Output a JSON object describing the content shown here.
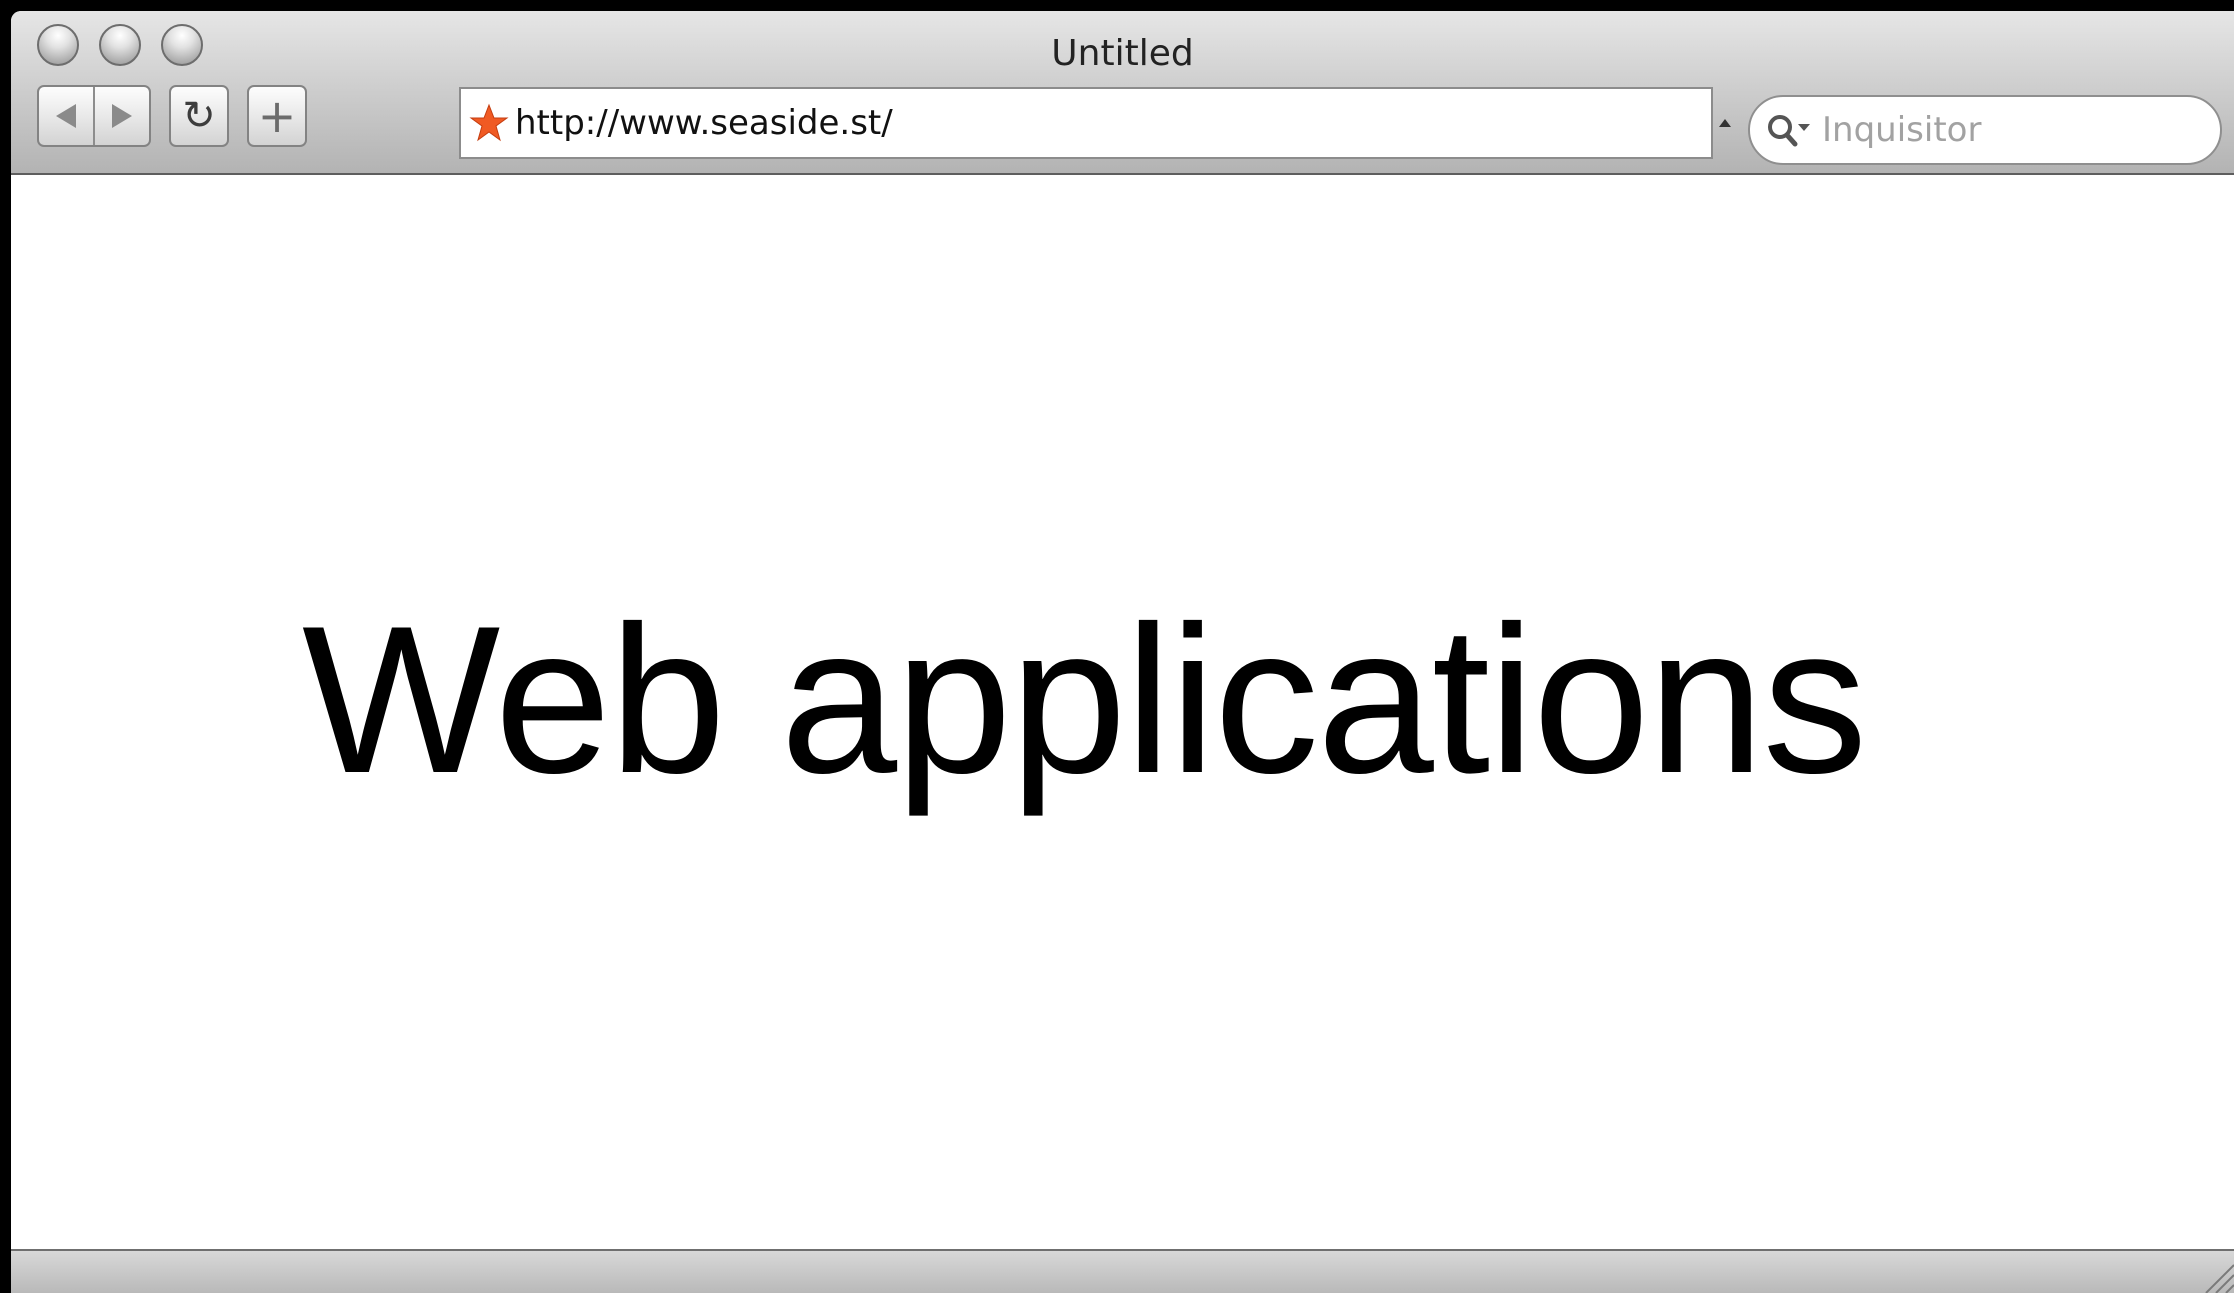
{
  "window": {
    "title": "Untitled"
  },
  "toolbar": {
    "back_icon": "back-arrow-icon",
    "forward_icon": "forward-arrow-icon",
    "reload_glyph": "↻",
    "add_bookmark_glyph": "+"
  },
  "address_bar": {
    "favicon": "starfish-icon",
    "url": "http://www.seaside.st/"
  },
  "search": {
    "placeholder": "Inquisitor"
  },
  "page": {
    "headline": "Web applications"
  },
  "colors": {
    "favicon": "#f05a23",
    "page_background": "#ffffff",
    "text": "#000000"
  }
}
